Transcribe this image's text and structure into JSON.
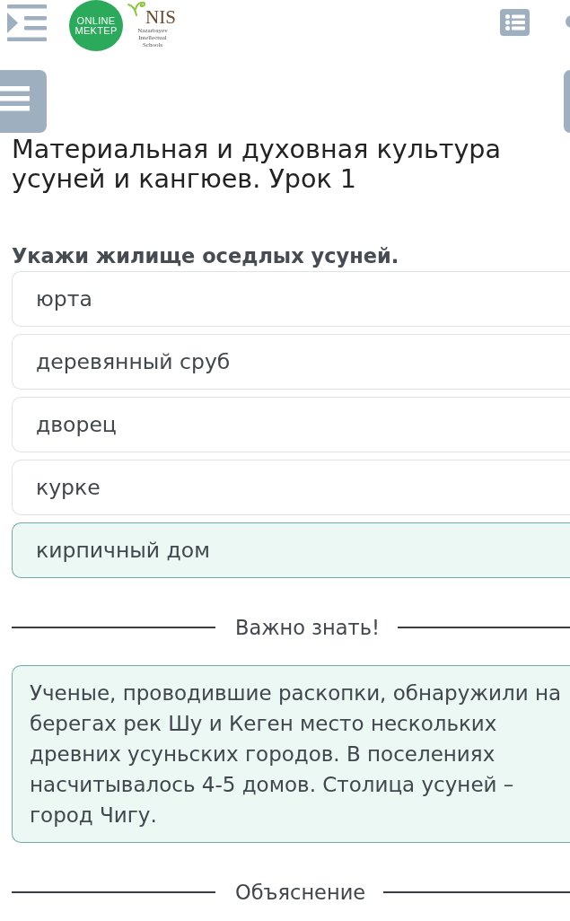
{
  "header": {
    "logo": {
      "badge_lines": [
        "ONLINE",
        "MEKTEP"
      ],
      "brand": "NIS",
      "caption_lines": [
        "Nazarbayev",
        "Intellectual",
        "Schools"
      ]
    }
  },
  "lesson": {
    "title": "Материальная и духовная культура усуней и кангюев. Урок 1"
  },
  "question": {
    "text": "Укажи жилище оседлых усуней.",
    "options": [
      {
        "label": "юрта",
        "selected": false
      },
      {
        "label": "деревянный сруб",
        "selected": false
      },
      {
        "label": "дворец",
        "selected": false
      },
      {
        "label": "курке",
        "selected": false
      },
      {
        "label": "кирпичный дом",
        "selected": true
      }
    ]
  },
  "sections": [
    {
      "heading": "Важно знать!",
      "body": "Ученые, проводившие раскопки, обнаружили на берегах рек Шу и Кеген место нескольких древних усуньских городов. В поселениях насчитывалось 4-5 домов. Столица усуней – город Чигу."
    },
    {
      "heading": "Объяснение"
    }
  ]
}
